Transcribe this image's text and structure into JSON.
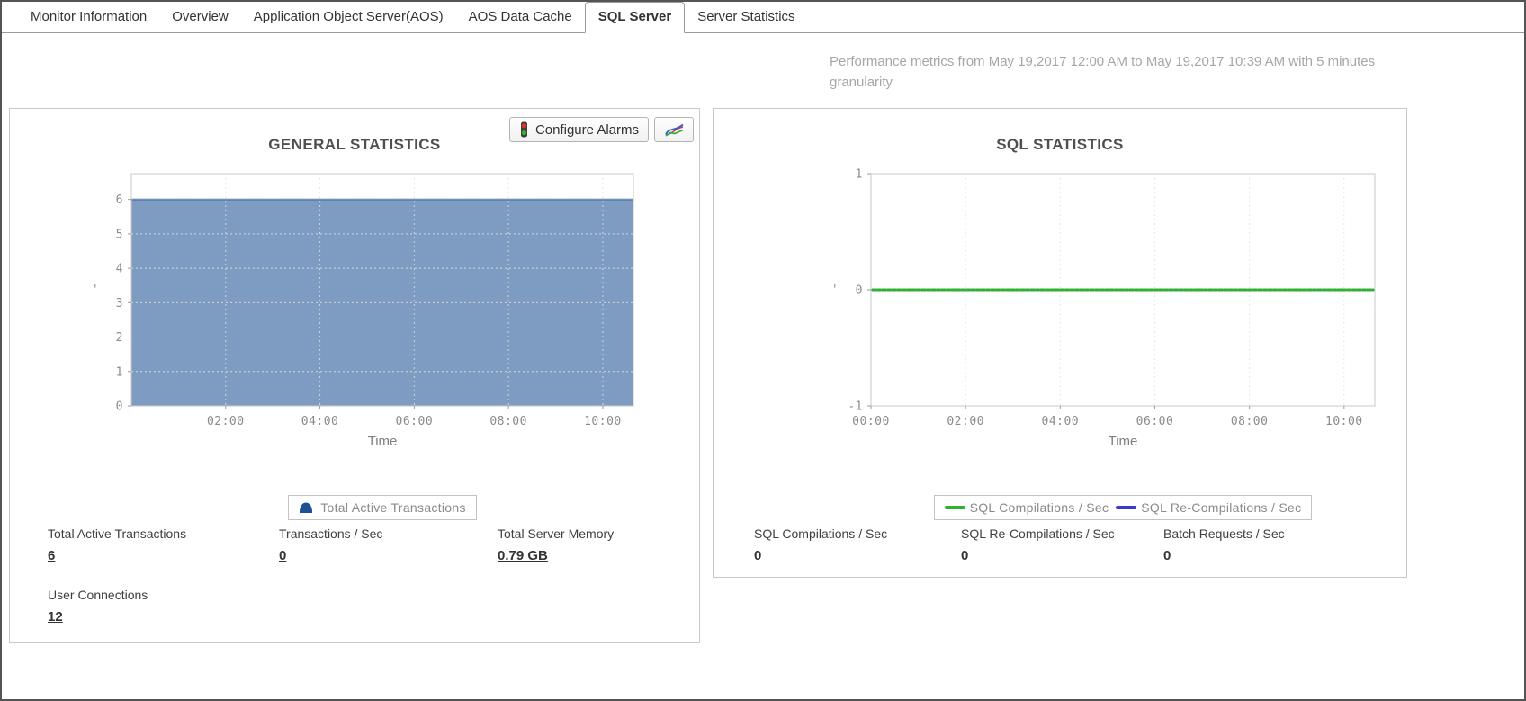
{
  "tabs": {
    "items": [
      {
        "label": "Monitor Information",
        "active": false
      },
      {
        "label": "Overview",
        "active": false
      },
      {
        "label": "Application Object Server(AOS)",
        "active": false
      },
      {
        "label": "AOS Data Cache",
        "active": false
      },
      {
        "label": "SQL Server",
        "active": true
      },
      {
        "label": "Server Statistics",
        "active": false
      }
    ]
  },
  "header": {
    "metrics_note": "Performance metrics from May 19,2017 12:00 AM to May 19,2017 10:39 AM with 5 minutes granularity"
  },
  "toolbar": {
    "configure_alarms_label": "Configure Alarms"
  },
  "icons": {
    "configure_alarms": "traffic-light-icon",
    "graph_button": "line-chart-icon",
    "general_legend": "area-swatch-icon"
  },
  "colors": {
    "page_border": "#545454",
    "panel_border": "#c9c9c9",
    "muted_text": "#a6a6a6",
    "title_text": "#4f4f4f",
    "tick_text": "#8b8b8b",
    "area_fill": "#7e9cc1",
    "area_series": "#1d4f92",
    "green_series": "#2eb32e",
    "blue_series": "#3a3ad0"
  },
  "panels": {
    "general": {
      "stats": [
        {
          "label": "Total Active Transactions",
          "value": "6"
        },
        {
          "label": "Transactions / Sec",
          "value": "0"
        },
        {
          "label": "Total Server Memory",
          "value": "0.79 GB"
        },
        {
          "label": "User Connections",
          "value": "12"
        }
      ]
    },
    "sql": {
      "stats": [
        {
          "label": "SQL Compilations / Sec",
          "value": "0"
        },
        {
          "label": "SQL Re-Compilations / Sec",
          "value": "0"
        },
        {
          "label": "Batch Requests / Sec",
          "value": "0"
        }
      ]
    }
  },
  "chart_data": [
    {
      "type": "area",
      "title": "GENERAL STATISTICS",
      "xlabel": "Time",
      "ylabel": "'",
      "x_range": [
        "00:00",
        "10:39"
      ],
      "xticks": [
        "02:00",
        "04:00",
        "06:00",
        "08:00",
        "10:00"
      ],
      "yticks": [
        0,
        1,
        2,
        3,
        4,
        5,
        6
      ],
      "ylim": [
        0,
        6.75
      ],
      "grid": true,
      "legend_position": "bottom",
      "series": [
        {
          "name": "Total Active Transactions",
          "color": "#1d4f92",
          "fill": "#7e9cc1",
          "constant_value": 6
        }
      ]
    },
    {
      "type": "line",
      "title": "SQL STATISTICS",
      "xlabel": "Time",
      "ylabel": "'",
      "x_range": [
        "00:00",
        "10:39"
      ],
      "xticks": [
        "00:00",
        "02:00",
        "04:00",
        "06:00",
        "08:00",
        "10:00"
      ],
      "yticks": [
        1,
        0,
        -1
      ],
      "ylim": [
        -1,
        1
      ],
      "grid": true,
      "legend_position": "bottom",
      "series": [
        {
          "name": "SQL Compilations / Sec",
          "color": "#2eb32e",
          "constant_value": 0
        },
        {
          "name": "SQL Re-Compilations / Sec",
          "color": "#3a3ad0",
          "constant_value": 0
        }
      ]
    }
  ]
}
